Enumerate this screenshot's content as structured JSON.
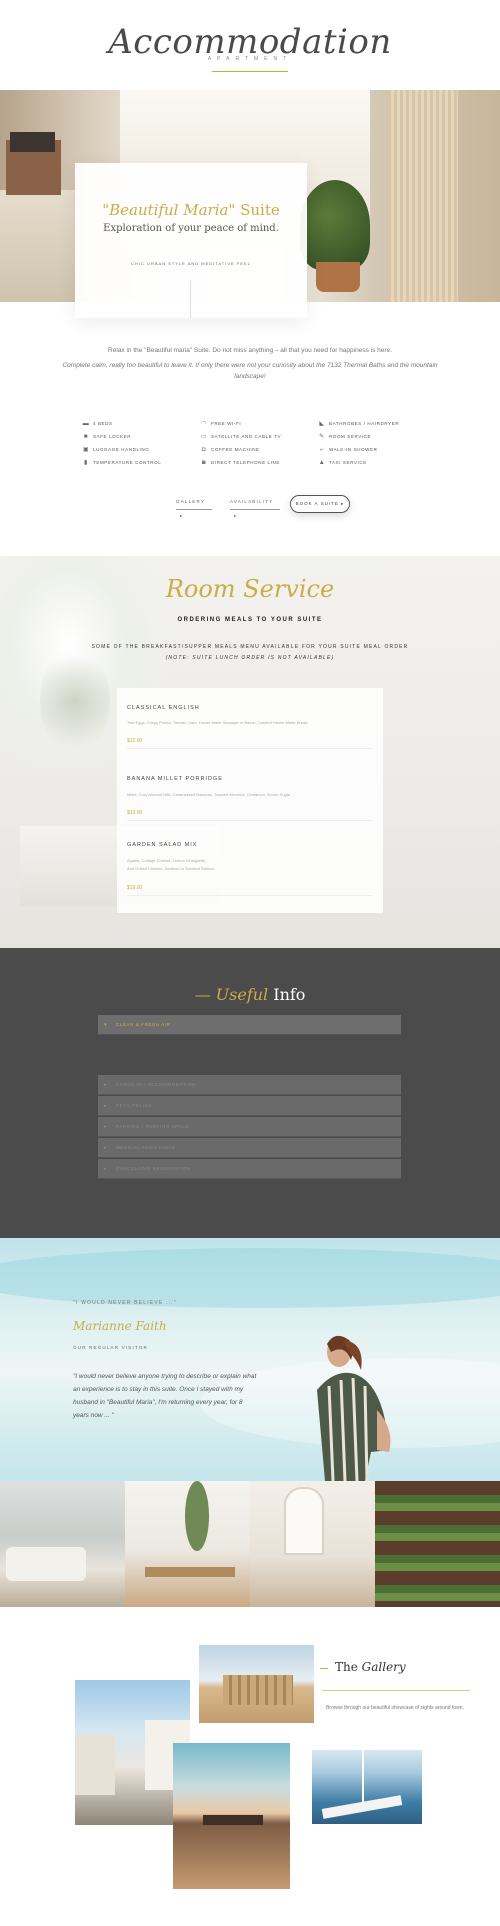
{
  "header": {
    "title": "Accommodation",
    "subtitle": "APARTMENT"
  },
  "hero": {
    "title_quote": "\"Beautiful Maria\"",
    "title_rest": " Suite",
    "subtitle": "Exploration of your peace of mind.",
    "tagline": "CHIC URBAN STYLE AND MEDITATIVE FEEL"
  },
  "intro": {
    "line1": "Relax in the \"Beautiful maria\" Suite. Do not miss anything – all that you need for happiness is here.",
    "line2": "Complete calm, really too beautiful to leave it. If only there were not your curiosity about the 7132 Thermal Baths and the mountain landscape!"
  },
  "amenities": [
    {
      "icon": "bed-icon",
      "glyph": "▬",
      "label": "4 BEDS"
    },
    {
      "icon": "wifi-icon",
      "glyph": "◠",
      "label": "FREE WI-FI"
    },
    {
      "icon": "bathrobe-icon",
      "glyph": "◣",
      "label": "BATHROBES / HAIRDRYER"
    },
    {
      "icon": "lock-icon",
      "glyph": "■",
      "label": "SAFE LOCKER"
    },
    {
      "icon": "tv-icon",
      "glyph": "▭",
      "label": "SATELLITE AND CABLE TV"
    },
    {
      "icon": "room-service-icon",
      "glyph": "✎",
      "label": "ROOM SERVICE"
    },
    {
      "icon": "luggage-icon",
      "glyph": "▣",
      "label": "LUGGAGE HANDLING"
    },
    {
      "icon": "coffee-icon",
      "glyph": "◘",
      "label": "COFFEE MACHINE"
    },
    {
      "icon": "shower-icon",
      "glyph": "⌐",
      "label": "WALK-IN SHOWER"
    },
    {
      "icon": "thermometer-icon",
      "glyph": "▮",
      "label": "TEMPERATURE CONTROL"
    },
    {
      "icon": "phone-icon",
      "glyph": "◙",
      "label": "DIRECT TELEPHONE LINE"
    },
    {
      "icon": "taxi-icon",
      "glyph": "▲",
      "label": "TAXI SERVICE"
    }
  ],
  "nav": {
    "gallery": "GALLERY",
    "availability": "AVAILABILITY",
    "book": "BOOK A SUITE",
    "arrow": "▸"
  },
  "room_service": {
    "title": "Room Service",
    "subtitle": "ORDERING MEALS TO YOUR SUITE",
    "note1": "SOME OF THE BREAKFAST/SUPPER MEALS MENU AVAILABLE FOR YOUR SUITE MEAL ORDER",
    "note2": "(NOTE: SUITE LUNCH ORDER IS NOT AVAILABLE)",
    "items": [
      {
        "name": "CLASSICAL ENGLISH",
        "desc": "Two Eggs, Crispy Potato, Tomato, Ham, House Made Sausage or Bacon, Toasted House Made Bread",
        "price": "$12.00"
      },
      {
        "name": "BANANA MILLET PORRIDGE",
        "desc": "Millet, Cozy Almond Milk, Caramelized Bananas, Toasted Almonds, Cinnamon, Brown Sugar",
        "price": "$13.00"
      },
      {
        "name": "GARDEN SALAD MIX",
        "desc": "Apples, Cottage Cheese, Lemon Vinaigrette,",
        "desc2": "And Grilled Chicken, Seafood or Smoked Salmon",
        "price": "$19.00"
      }
    ]
  },
  "useful_info": {
    "title_ital": "Useful",
    "title_rest": " Info",
    "items": [
      {
        "label": "CLEAN & FRESH AIR"
      },
      {
        "label": "CHECK IN / ACCOMMODATION"
      },
      {
        "label": "PETS POLICE"
      },
      {
        "label": "PARKING / PARKING SPACE"
      },
      {
        "label": "MEDICAL ASSISTANCE"
      },
      {
        "label": "CANCELLING RESERVATION"
      }
    ]
  },
  "testimonial": {
    "kicker": "\"I WOULD NEVER BELIEVE ...\"",
    "name": "Marianne Faith",
    "role": "OUR REGULAR VISITOR",
    "quote": "\"I would never believe anyone trying to describe or explain what an experience is to stay in this suite. Once I stayed with my husband in \"Beautiful Maria\", I'm returning every year, for 8 years now ... \""
  },
  "gallery": {
    "title_pre": "The ",
    "title_ital": "Gallery",
    "desc": "Browse through our beautiful showcase of sights around town."
  },
  "colors": {
    "accent_gold": "#c9ad47",
    "dark_bg": "#4b4b4b",
    "accordion": "#6a6a6a"
  }
}
